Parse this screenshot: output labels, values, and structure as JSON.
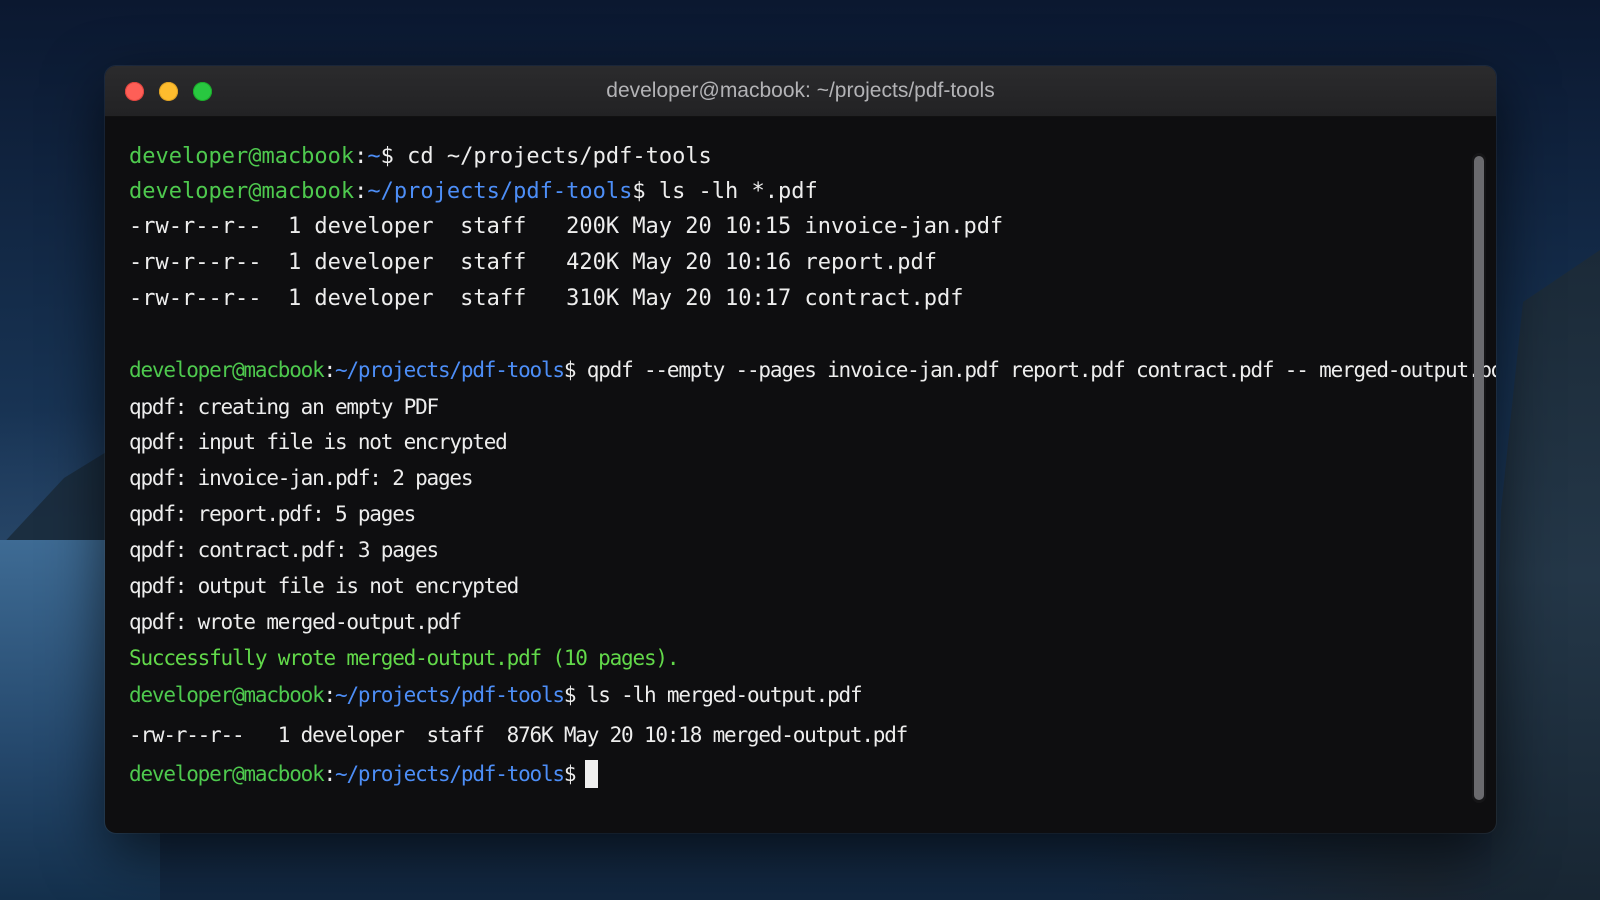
{
  "window": {
    "title": "developer@macbook: ~/projects/pdf-tools"
  },
  "terminal": {
    "lines": [
      {
        "kind": "prompt",
        "user": "developer@macbook",
        "path": "~",
        "command": " cd ~/projects/pdf-tools"
      },
      {
        "kind": "prompt",
        "user": "developer@macbook",
        "path": "~/projects/pdf-tools",
        "command": " ls -lh *.pdf"
      },
      {
        "kind": "output",
        "text": "-rw-r--r--  1 developer  staff   200K May 20 10:15 invoice-jan.pdf"
      },
      {
        "kind": "output",
        "text": "-rw-r--r--  1 developer  staff   420K May 20 10:16 report.pdf"
      },
      {
        "kind": "output",
        "text": "-rw-r--r--  1 developer  staff   310K May 20 10:17 contract.pdf"
      },
      {
        "kind": "prompt",
        "user": "developer@macbook",
        "path": "~/projects/pdf-tools",
        "command": " qpdf --empty --pages invoice-jan.pdf report.pdf contract.pdf -- merged-output.pdf"
      },
      {
        "kind": "output",
        "text": "qpdf: creating an empty PDF"
      },
      {
        "kind": "output",
        "text": "qpdf: input file is not encrypted"
      },
      {
        "kind": "output",
        "text": "qpdf: invoice-jan.pdf: 2 pages"
      },
      {
        "kind": "output",
        "text": "qpdf: report.pdf: 5 pages"
      },
      {
        "kind": "output",
        "text": "qpdf: contract.pdf: 3 pages"
      },
      {
        "kind": "output",
        "text": "qpdf: output file is not encrypted"
      },
      {
        "kind": "output",
        "text": "qpdf: wrote merged-output.pdf"
      },
      {
        "kind": "success",
        "text": "Successfully wrote merged-output.pdf (10 pages)."
      },
      {
        "kind": "prompt",
        "user": "developer@macbook",
        "path": "~/projects/pdf-tools",
        "command": " ls -lh merged-output.pdf"
      },
      {
        "kind": "output",
        "text": "-rw-r--r--   1 developer  staff  876K May 20 10:18 merged-output.pdf"
      },
      {
        "kind": "prompt-active",
        "user": "developer@macbook",
        "path": "~/projects/pdf-tools",
        "command": ""
      }
    ],
    "prompt_separator": ":",
    "prompt_symbol": "$"
  },
  "colors": {
    "prompt_user": "#4ec94e",
    "prompt_path": "#4d8ef7",
    "output": "#ededed",
    "success": "#62d84a",
    "background": "#0e0e10"
  }
}
